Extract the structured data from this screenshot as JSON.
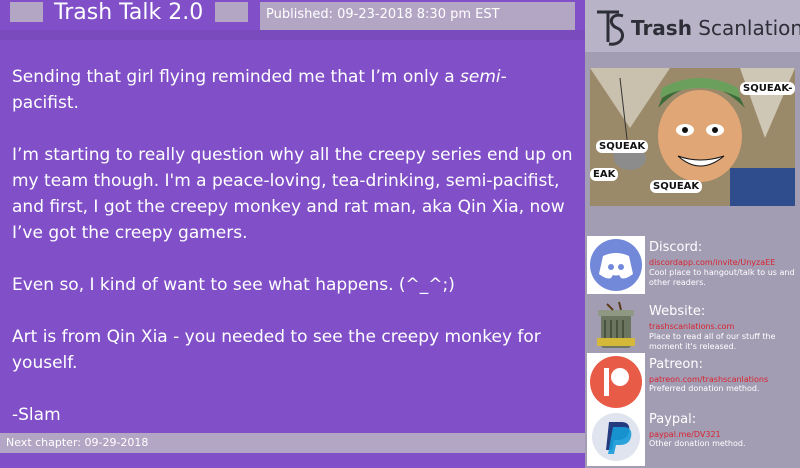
{
  "header": {
    "title": "Trash Talk 2.0",
    "published": "Published: 09-23-2018 8:30 pm EST"
  },
  "content": {
    "p1_before": "Sending that girl flying reminded me that I’m only a ",
    "p1_em": "semi",
    "p1_after": "-pacifist.",
    "p2": "I’m starting to really question why all the creepy series end up on my team though. I'm a peace-loving, tea-drinking, semi-pacifist, and first, I got the creepy monkey and rat man, aka Qin Xia, now I’ve got the creepy gamers.",
    "p3": "Even so, I kind of want to see what happens. (^_^;)",
    "p4": "Art is from Qin Xia - you needed to see the creepy monkey for youself.",
    "signature": "-Slam"
  },
  "footer": {
    "next_chapter": "Next chapter: 09-29-2018"
  },
  "sidebar": {
    "logo_text_bold": "Trash",
    "logo_text_rest": " Scanlations",
    "art_sfx": [
      "SQUEAK-",
      "SQUEAK",
      "SQUEAK",
      "EAK"
    ],
    "contacts": [
      {
        "label": "Discord:",
        "link": "discordapp.com/invite/UnyzaEE",
        "desc": "Cool place to hangout/talk to us and other readers.",
        "icon": "discord-icon",
        "color": "#7289da"
      },
      {
        "label": "Website:",
        "link": "trashscanlations.com",
        "desc": "Place to read all of our stuff the moment it's released.",
        "icon": "trash-can-mascot-icon",
        "color": "#4a5a3a"
      },
      {
        "label": "Patreon:",
        "link": "patreon.com/trashscanlations",
        "desc": "Preferred donation method.",
        "icon": "patreon-icon",
        "color": "#e85b46"
      },
      {
        "label": "Paypal:",
        "link": "paypal.me/DV321",
        "desc": "Other donation method.",
        "icon": "paypal-icon",
        "color": "#253b80"
      }
    ]
  }
}
